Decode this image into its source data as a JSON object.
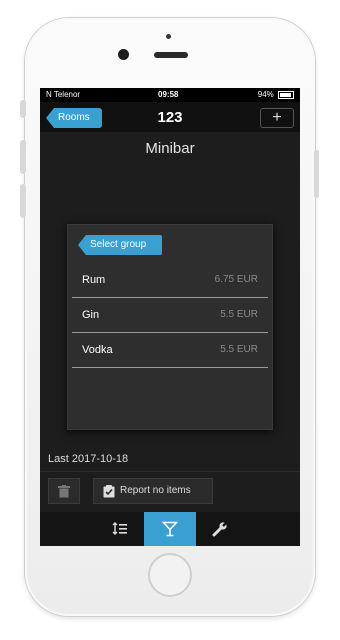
{
  "status_bar": {
    "carrier": "N Telenor",
    "time": "09:58",
    "battery": "94%"
  },
  "nav": {
    "back_label": "Rooms",
    "title": "123",
    "add_label": "+"
  },
  "page_title": "Minibar",
  "select_group_label": "Select group",
  "items": [
    {
      "name": "Rum",
      "price": "6.75 EUR"
    },
    {
      "name": "Gin",
      "price": "5.5 EUR"
    },
    {
      "name": "Vodka",
      "price": "5.5 EUR"
    }
  ],
  "last_label": "Last 2017-10-18",
  "report_label": "Report no items",
  "tabs": [
    {
      "icon": "list-order-icon",
      "active": false
    },
    {
      "icon": "cocktail-icon",
      "active": true
    },
    {
      "icon": "wrench-icon",
      "active": false
    }
  ],
  "colors": {
    "accent": "#3aa0d2",
    "background": "#1d1d1d"
  }
}
